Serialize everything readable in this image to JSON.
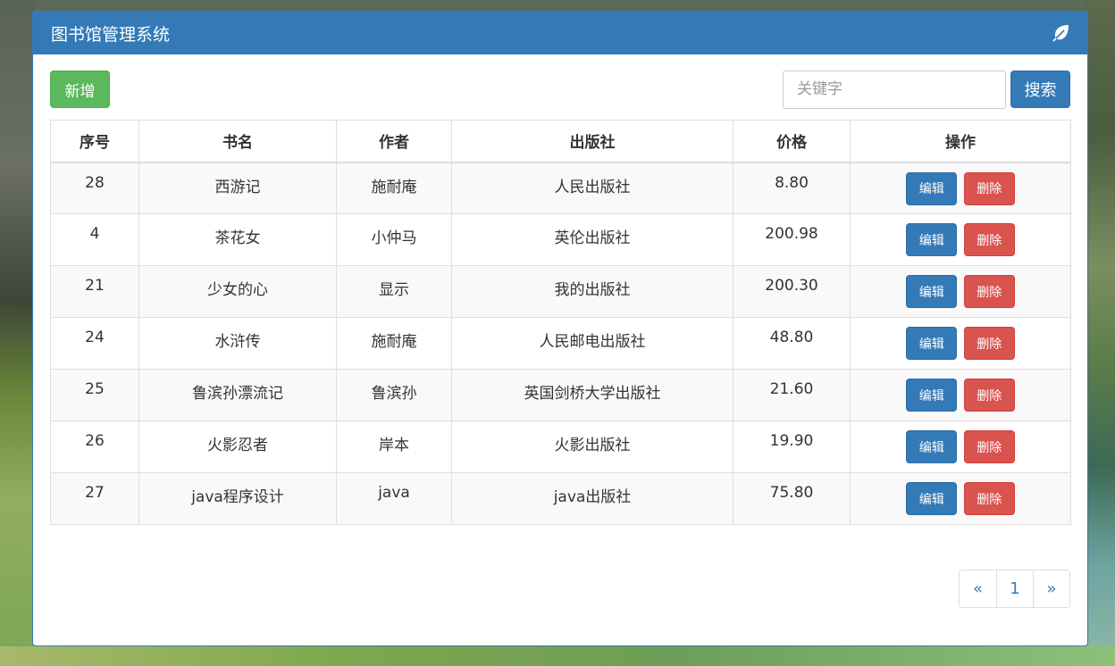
{
  "header": {
    "title": "图书馆管理系统",
    "icon": "leaf-icon"
  },
  "toolbar": {
    "add_label": "新增",
    "search_placeholder": "关键字",
    "search_value": "",
    "search_label": "搜索"
  },
  "table": {
    "columns": [
      "序号",
      "书名",
      "作者",
      "出版社",
      "价格",
      "操作"
    ],
    "rows": [
      {
        "id": "28",
        "title": "西游记",
        "author": "施耐庵",
        "publisher": "人民出版社",
        "price": "8.80"
      },
      {
        "id": "4",
        "title": "茶花女",
        "author": "小仲马",
        "publisher": "英伦出版社",
        "price": "200.98"
      },
      {
        "id": "21",
        "title": "少女的心",
        "author": "显示",
        "publisher": "我的出版社",
        "price": "200.30"
      },
      {
        "id": "24",
        "title": "水浒传",
        "author": "施耐庵",
        "publisher": "人民邮电出版社",
        "price": "48.80"
      },
      {
        "id": "25",
        "title": "鲁滨孙漂流记",
        "author": "鲁滨孙",
        "publisher": "英国剑桥大学出版社",
        "price": "21.60"
      },
      {
        "id": "26",
        "title": "火影忍者",
        "author": "岸本",
        "publisher": "火影出版社",
        "price": "19.90"
      },
      {
        "id": "27",
        "title": "java程序设计",
        "author": "java",
        "publisher": "java出版社",
        "price": "75.80"
      }
    ],
    "edit_label": "编辑",
    "delete_label": "删除"
  },
  "pagination": {
    "prev": "«",
    "current": "1",
    "next": "»"
  },
  "colors": {
    "primary": "#337ab7",
    "success": "#5cb85c",
    "danger": "#d9534f"
  }
}
